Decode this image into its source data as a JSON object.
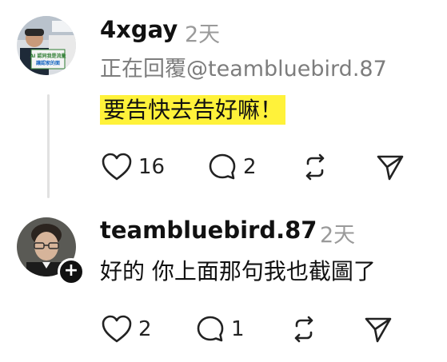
{
  "post": {
    "username": "4xgay",
    "time": "2天",
    "reply_to": "正在回覆@teambluebird.87",
    "text": "要告快去告好嘛！",
    "likes": "16",
    "replies": "2",
    "avatar_sign_text": "AI 認同我是流量 讓認家的面"
  },
  "reply": {
    "username": "teambluebird.87",
    "time": "2天",
    "text": "好的 你上面那句我也截圖了",
    "likes": "2",
    "replies": "1"
  },
  "icons": {
    "like": "heart-icon",
    "reply": "comment-bubble-icon",
    "repost": "repost-icon",
    "share": "send-paper-plane-icon",
    "follow": "plus-icon"
  },
  "colors": {
    "highlight": "#fff23a",
    "text": "#111111",
    "muted": "#9a9a9a"
  }
}
